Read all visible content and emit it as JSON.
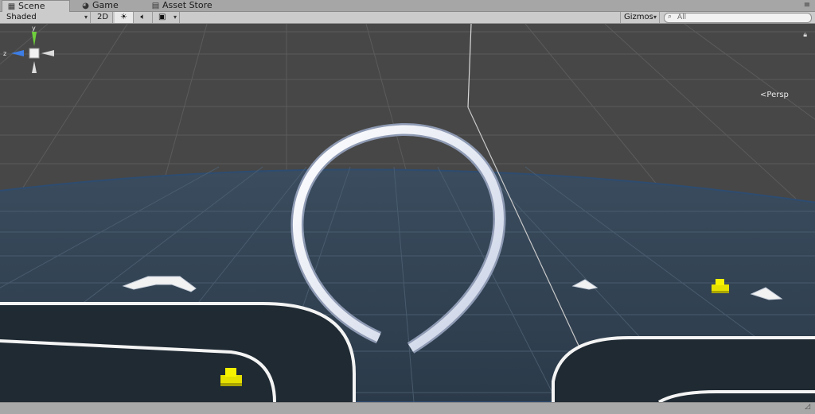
{
  "tabs": [
    {
      "label": "Scene",
      "icon": "grid-icon",
      "active": true
    },
    {
      "label": "Game",
      "icon": "pacman-icon",
      "active": false
    },
    {
      "label": "Asset Store",
      "icon": "store-icon",
      "active": false
    }
  ],
  "toolbar": {
    "shading_mode": "Shaded",
    "mode_2d": "2D",
    "gizmos_label": "Gizmos",
    "search_placeholder": "All"
  },
  "scene_gizmo": {
    "axis_y": "y",
    "axis_z": "z",
    "projection": "Persp"
  },
  "colors": {
    "sky": "#474747",
    "ground": "#2f3f4f",
    "ring": "#eef1f8",
    "track": "#1f2a33",
    "car": "#e6e000",
    "y_axis": "#6fcf3c",
    "z_axis": "#3d7ee6"
  }
}
